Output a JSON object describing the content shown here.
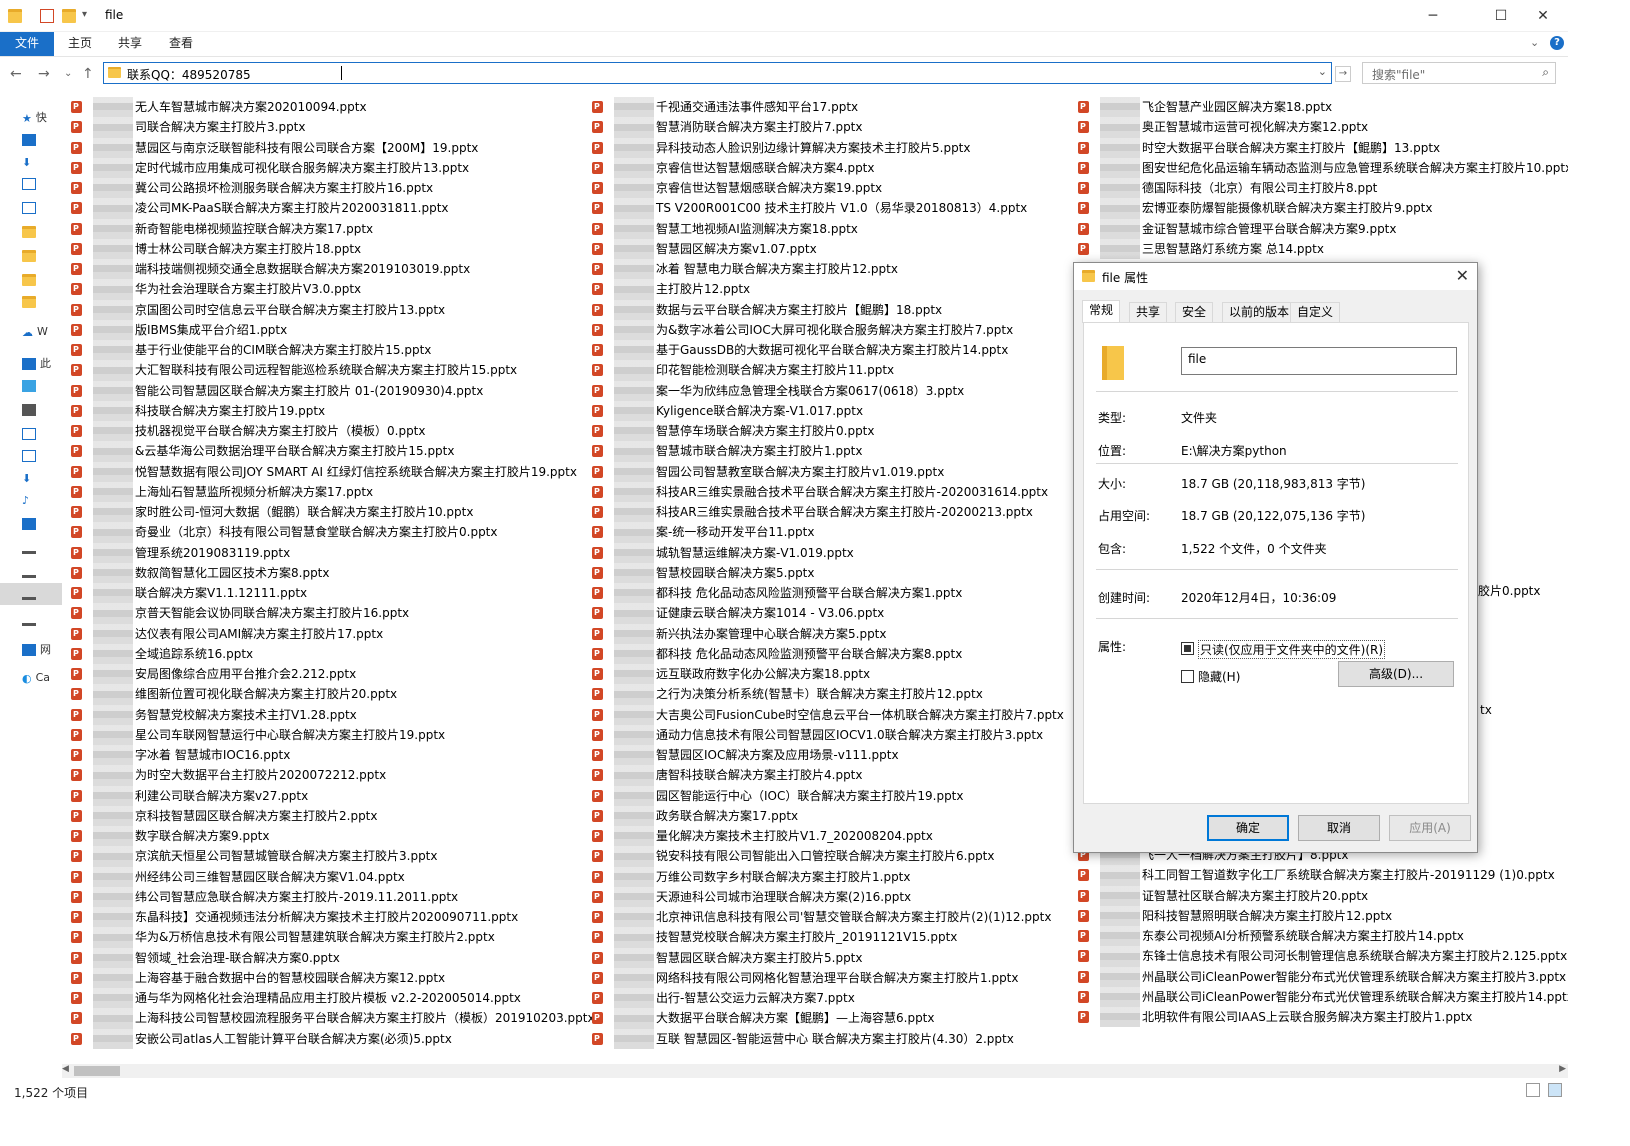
{
  "window": {
    "title": "file",
    "controls": {
      "minimize": "─",
      "maximize": "☐",
      "close": "✕"
    }
  },
  "ribbon": {
    "tabs": [
      "文件",
      "主页",
      "共享",
      "查看"
    ]
  },
  "address": {
    "path": "联系QQ：489520785",
    "search_placeholder": "搜索\"file\""
  },
  "nav_pane": {
    "items": [
      "快",
      "",
      "",
      "",
      "",
      "",
      "",
      "",
      "",
      "",
      "W",
      "此",
      "",
      "",
      "",
      "",
      "",
      "",
      "",
      "",
      "",
      "",
      "",
      "",
      "网",
      "Ca"
    ]
  },
  "files": {
    "col1": [
      "无人车智慧城市解决方案202010094.pptx",
      "司联合解决方案主打胶片3.pptx",
      "慧园区与南京泛联智能科技有限公司联合方案【200M】19.pptx",
      "定时代城市应用集成可视化联合服务解决方案主打胶片13.pptx",
      "冀公司公路损坏检测服务联合解决方案主打胶片16.pptx",
      "凌公司MK-PaaS联合解决方案主打胶片2020031811.pptx",
      "新奇智能电梯视频监控联合解决方案17.pptx",
      "博士林公司联合解决方案主打胶片18.pptx",
      "端科技端侧视频交通全息数据联合解决方案2019103019.pptx",
      "华为社会治理联合方案主打胶片V3.0.pptx",
      "京国图公司时空信息云平台联合解决方案主打胶片13.pptx",
      "版IBMS集成平台介绍1.pptx",
      "基于行业使能平台的CIM联合解决方案主打胶片15.pptx",
      "大汇智联科技有限公司远程智能巡检系统联合解决方案主打胶片15.pptx",
      "智能公司智慧园区联合解决方案主打胶片 01-(20190930)4.pptx",
      "科技联合解决方案主打胶片19.pptx",
      "技机器视觉平台联合解决方案主打胶片（模板）0.pptx",
      "&云基华海公司数据治理平台联合解决方案主打胶片15.pptx",
      "悦智慧数据有限公司JOY SMART AI 红绿灯信控系统联合解决方案主打胶片19.pptx",
      "上海灿石智慧监所视频分析解决方案17.pptx",
      "家时胜公司-恒河大数据（鲲鹏）联合解决方案主打胶片10.pptx",
      "奇曼业（北京）科技有限公司智慧食堂联合解决方案主打胶片0.pptx",
      "管理系统2019083119.pptx",
      "数叙简智慧化工园区技术方案8.pptx",
      "联合解决方案V1.1.12111.pptx",
      "京普天智能会议协同联合解决方案主打胶片16.pptx",
      "达仪表有限公司AMI解决方案主打胶片17.pptx",
      "全域追踪系统16.pptx",
      "安局图像综合应用平台推介会2.212.pptx",
      "维图新位置可视化联合解决方案主打胶片20.pptx",
      "务智慧党校解决方案技术主打V1.28.pptx",
      "星公司车联网智慧运行中心联合解决方案主打胶片19.pptx",
      "字冰着 智慧城市IOC16.pptx",
      "为时空大数据平台主打胶片2020072212.pptx",
      "利建公司联合解决方案v27.pptx",
      "京科技智慧园区联合解决方案主打胶片2.pptx",
      "数字联合解决方案9.pptx",
      "京滨航天恒星公司智慧城管联合解决方案主打胶片3.pptx",
      "州经纬公司三维智慧园区联合解决方案V1.04.pptx",
      "纬公司智慧应急联合解决方案主打胶片-2019.11.2011.pptx",
      "东晶科技】交通视频违法分析解决方案技术主打胶片2020090711.pptx",
      "华为&万桥信息技术有限公司智慧建筑联合解决方案主打胶片2.pptx",
      "智领域_社会治理-联合解决方案0.pptx",
      "上海容基于融合数据中台的智慧校园联合解决方案12.pptx",
      "通与华为网格化社会治理精品应用主打胶片模板 v2.2-202005014.pptx",
      "上海科技公司智慧校园流程服务平台联合解决方案主打胶片（模板）201910203.pptx",
      "安嵌公司atlas人工智能计算平台联合解决方案(必须)5.pptx"
    ],
    "col2": [
      "千视通交通违法事件感知平台17.pptx",
      "智慧消防联合解决方案主打胶片7.pptx",
      "异科技动态人脸识别边缘计算解决方案技术主打胶片5.pptx",
      "京睿信世达智慧烟感联合解决方案4.pptx",
      "京睿信世达智慧烟感联合解决方案19.pptx",
      "TS V200R001C00 技术主打胶片 V1.0（易华录20180813）4.pptx",
      "智慧工地视频AI监测解决方案18.pptx",
      "智慧园区解决方案v1.07.pptx",
      "冰着 智慧电力联合解决方案主打胶片12.pptx",
      "主打胶片12.pptx",
      "数据与云平台联合解决方案主打胶片【鲲鹏】18.pptx",
      "为&数字冰着公司IOC大屏可视化联合服务解决方案主打胶片7.pptx",
      "基于GaussDB的大数据可视化平台联合解决方案主打胶片14.pptx",
      "印花智能检测联合解决方案主打胶片11.pptx",
      "案一华为欣纬应急管理全栈联合方案0617(0618）3.pptx",
      "Kyligence联合解决方案-V1.017.pptx",
      "智慧停车场联合解决方案主打胶片0.pptx",
      "智慧城市联合解决方案主打胶片1.pptx",
      "智园公司智慧教室联合解决方案主打胶片v1.019.pptx",
      "科技AR三维实景融合技术平台联合解决方案主打胶片-2020031614.pptx",
      "科技AR三维实景融合技术平台联合解决方案主打胶片-20200213.pptx",
      "案-统一移动开发平台11.pptx",
      "城轨智慧运维解决方案-V1.019.pptx",
      "智慧校园联合解决方案5.pptx",
      "都科技 危化品动态风险监测预警平台联合解决方案1.pptx",
      "证健康云联合解决方案1014 - V3.06.pptx",
      "新兴执法办案管理中心联合解决方案5.pptx",
      "都科技 危化品动态风险监测预警平台联合解决方案8.pptx",
      "远互联政府数字化办公解决方案18.pptx",
      "之行为决策分析系统(智慧卡）联合解决方案主打胶片12.pptx",
      "大吉奥公司FusionCube时空信息云平台一体机联合解决方案主打胶片7.pptx",
      "通动力信息技术有限公司智慧园区IOCV1.0联合解决方案主打胶片3.pptx",
      "智慧园区IOC解决方案及应用场景-v111.pptx",
      "唐智科技联合解决方案主打胶片4.pptx",
      "园区智能运行中心（IOC）联合解决方案主打胶片19.pptx",
      "政务联合解决方案17.pptx",
      "量化解决方案技术主打胶片V1.7_202008204.pptx",
      "锐安科技有限公司智能出入口管控联合解决方案主打胶片6.pptx",
      "万维公司数字乡村联合解决方案主打胶片1.pptx",
      "天源迪科公司城市治理联合解决方案(2)16.pptx",
      "北京神讯信息科技有限公司'智慧交管联合解决方案主打胶片(2)(1)12.pptx",
      "技智慧党校联合解决方案主打胶片_20191121V15.pptx",
      "智慧园区联合解决方案主打胶片5.pptx",
      "网络科技有限公司网格化智慧治理平台联合解决方案主打胶片1.pptx",
      "出行-智慧公交运力云解决方案7.pptx",
      "大数据平台联合解决方案【鲲鹏】—上海容慧6.pptx",
      "互联 智慧园区-智能运营中心 联合解决方案主打胶片(4.30）2.pptx"
    ],
    "col3_top": [
      "飞企智慧产业园区解决方案18.pptx",
      "奥正智慧城市运营可视化解决方案12.pptx",
      "时空大数据平台联合解决方案主打胶片【鲲鹏】13.pptx",
      "图安世纪危化品运输车辆动态监测与应急管理系统联合解决方案主打胶片10.pptx",
      "德国际科技（北京）有限公司主打胶片8.ppt",
      "宏博亚泰防爆智能摄像机联合解决方案主打胶片9.pptx",
      "金证智慧城市综合管理平台联合解决方案9.pptx",
      "三思智慧路灯系统方案 总14.pptx"
    ],
    "col3_peek": [
      "胶片0.pptx",
      "tx"
    ],
    "col3_bottom": [
      "飞一人一档解决方案主打胶片】8.pptx",
      "科工同智工智道数字化工厂系统联合解决方案主打胶片-20191129 (1)0.pptx",
      "证智慧社区联合解决方案主打胶片20.pptx",
      "阳科技智慧照明联合解决方案主打胶片12.pptx",
      "东泰公司视频AI分析预警系统联合解决方案主打胶片14.pptx",
      "东锋士信息技术有限公司河长制管理信息系统联合解决方案主打胶片2.125.pptx",
      "州晶联公司iCleanPower智能分布式光伏管理系统联合解决方案主打胶片3.pptx",
      "州晶联公司iCleanPower智能分布式光伏管理系统联合解决方案主打胶片14.pptx",
      "北明软件有限公司IAAS上云联合服务解决方案主打胶片1.pptx"
    ]
  },
  "status": {
    "count": "1,522 个项目"
  },
  "dialog": {
    "title": "file 属性",
    "close": "✕",
    "tabs": [
      "常规",
      "共享",
      "安全",
      "以前的版本",
      "自定义"
    ],
    "name": "file",
    "props": [
      {
        "label": "类型:",
        "value": "文件夹"
      },
      {
        "label": "位置:",
        "value": "E:\\解决方案python"
      },
      {
        "label": "大小:",
        "value": "18.7 GB (20,118,983,813 字节)"
      },
      {
        "label": "占用空间:",
        "value": "18.7 GB (20,122,075,136 字节)"
      },
      {
        "label": "包含:",
        "value": "1,522 个文件，0 个文件夹"
      }
    ],
    "created_label": "创建时间:",
    "created_value": "2020年12月4日，10:36:09",
    "attr_label": "属性:",
    "readonly_label": "只读(仅应用于文件夹中的文件)(R)",
    "hidden_label": "隐藏(H)",
    "advanced_button": "高级(D)...",
    "ok_button": "确定",
    "cancel_button": "取消",
    "apply_button": "应用(A)"
  }
}
